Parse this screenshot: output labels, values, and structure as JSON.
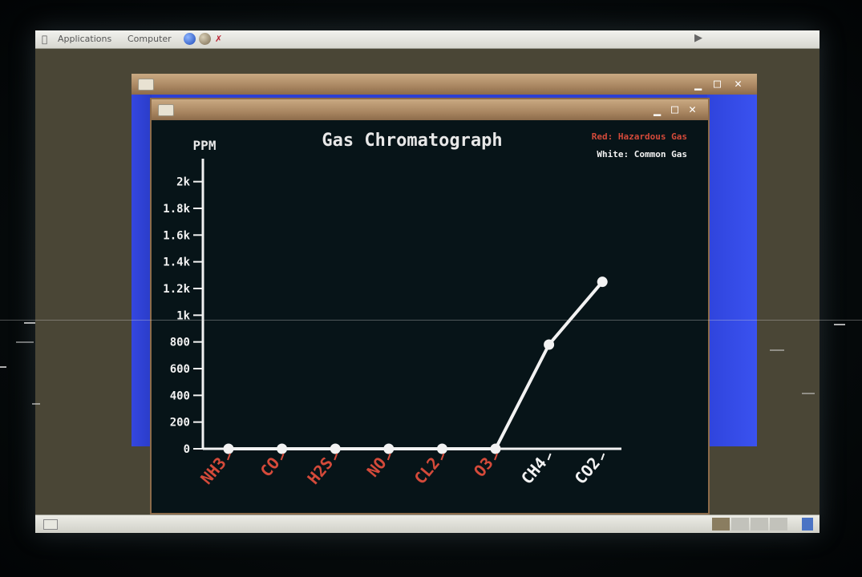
{
  "top_panel": {
    "applications": "Applications",
    "computer": "Computer"
  },
  "colors": {
    "hazardous": "#d44a3a",
    "common": "#f2f2f2",
    "axis": "#f2f2f2"
  },
  "icons": {
    "menu": "apple-icon",
    "globe": "globe-icon",
    "volume": "speaker-icon",
    "minimize": "minimize-icon",
    "maximize": "maximize-icon",
    "close": "close-icon"
  },
  "chart_data": {
    "type": "line",
    "title": "Gas Chromatograph",
    "ylabel": "PPM",
    "ylim": [
      0,
      2100
    ],
    "y_ticks": [
      {
        "value": 0,
        "label": "0"
      },
      {
        "value": 200,
        "label": "200"
      },
      {
        "value": 400,
        "label": "400"
      },
      {
        "value": 600,
        "label": "600"
      },
      {
        "value": 800,
        "label": "800"
      },
      {
        "value": 1000,
        "label": "1k"
      },
      {
        "value": 1200,
        "label": "1.2k"
      },
      {
        "value": 1400,
        "label": "1.4k"
      },
      {
        "value": 1600,
        "label": "1.6k"
      },
      {
        "value": 1800,
        "label": "1.8k"
      },
      {
        "value": 2000,
        "label": "2k"
      }
    ],
    "categories": [
      "NH3",
      "CO",
      "H2S",
      "NO",
      "CL2",
      "O3",
      "CH4",
      "CO2"
    ],
    "category_hazard": [
      true,
      true,
      true,
      true,
      true,
      true,
      false,
      false
    ],
    "series": [
      {
        "values": [
          0,
          0,
          0,
          0,
          0,
          0,
          780,
          1250
        ]
      }
    ],
    "legend": {
      "hazardous": "Red: Hazardous Gas",
      "common": "White: Common Gas",
      "placement": "top-right"
    },
    "grid": false
  }
}
